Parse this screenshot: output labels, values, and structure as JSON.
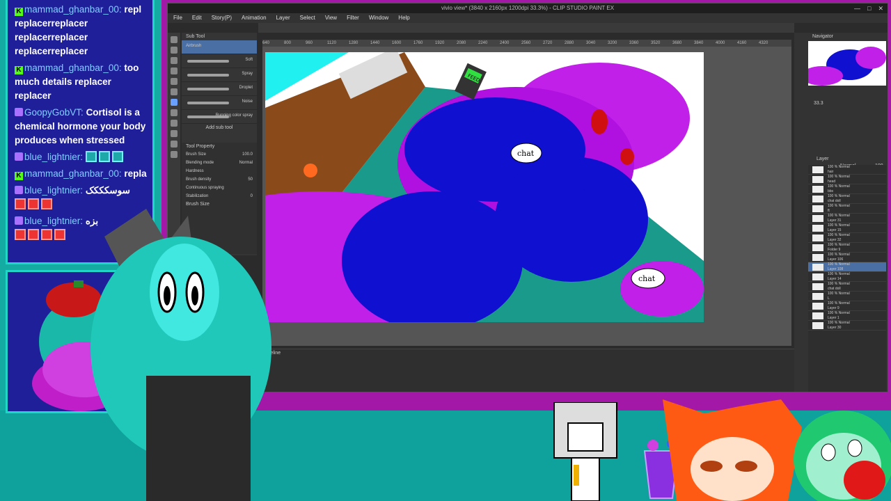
{
  "chat": {
    "messages": [
      {
        "user": "",
        "text": "replacer replacer",
        "badge": "k",
        "prefix": "mammad_ghanbar_00:",
        "tail": "repla"
      },
      {
        "user": "",
        "text": "replacer replacer"
      },
      {
        "user": "",
        "text": "replacer replacer"
      },
      {
        "user": "",
        "text": "replacer replacer"
      }
    ],
    "line1_user": "mammad_ghanbar_00:",
    "line1_text": "repl",
    "line2": "replacer",
    "line2b": "replacer",
    "line3": "replacer",
    "line3b": "replacer",
    "line4": "replacer",
    "line4b": "replacer",
    "msg2_user": "mammad_ghanbar_00:",
    "msg2_text": "too much details",
    "msg2_tail": "replacer",
    "msg2_tail2": "replacer",
    "msg3_user": "GoopyGobVT:",
    "msg3_text": "Cortisol is a chemical hormone your body produces when stressed",
    "msg4_user": "blue_lightnier:",
    "msg5_user": "mammad_ghanbar_00:",
    "msg5_text": "repla",
    "msg6_user": "blue_lightnier:",
    "msg6_text": "سوسکککک",
    "msg7_user": "blue_lightnier:",
    "msg7_text": "بزه"
  },
  "csp": {
    "title": "vivio view* (3840 x 2160px 1200dpi 33.3%) - CLIP STUDIO PAINT EX",
    "menus": [
      "File",
      "Edit",
      "Story(P)",
      "Animation",
      "Layer",
      "Select",
      "View",
      "Filter",
      "Window",
      "Help"
    ],
    "win_buttons": [
      "—",
      "□",
      "✕"
    ],
    "canvas_tab": "vivio view*",
    "subtool_title": "Sub Tool",
    "brushes": [
      {
        "name": "Airbrush",
        "tag": ""
      },
      {
        "name": "",
        "tag": "Soft"
      },
      {
        "name": "",
        "tag": "Spray"
      },
      {
        "name": "",
        "tag": "Droplet"
      },
      {
        "name": "",
        "tag": "Noise"
      },
      {
        "name": "",
        "tag": "Running color spray"
      }
    ],
    "add_sub_tool": "Add sub tool",
    "tool_property": "Tool Property",
    "props": [
      {
        "label": "Brush Size",
        "value": "100.0"
      },
      {
        "label": "Blending mode",
        "value": "Normal"
      },
      {
        "label": "Hardness",
        "value": ""
      },
      {
        "label": "Brush density",
        "value": "50"
      },
      {
        "label": "Continuous spraying",
        "value": ""
      },
      {
        "label": "Stabilization",
        "value": "0"
      }
    ],
    "brush_size_label": "Brush Size",
    "ruler_ticks": [
      "640",
      "800",
      "960",
      "1120",
      "1280",
      "1440",
      "1600",
      "1760",
      "1920",
      "2080",
      "2240",
      "2400",
      "2560",
      "2720",
      "2880",
      "3040",
      "3200",
      "3360",
      "3520",
      "3680",
      "3840",
      "4000",
      "4160",
      "4320"
    ],
    "timeline_label": "Timeline",
    "navigator_label": "Navigator",
    "zoom": "33.3",
    "layer_label": "Layer",
    "blend_mode": "Normal",
    "opacity": "100",
    "layers": [
      {
        "mode": "100 % Normal",
        "name": "hair"
      },
      {
        "mode": "100 % Normal",
        "name": "head"
      },
      {
        "mode": "100 % Normal",
        "name": "bbs"
      },
      {
        "mode": "100 % Normal",
        "name": "chat doll"
      },
      {
        "mode": "100 % Normal",
        "name": "ft"
      },
      {
        "mode": "100 % Normal",
        "name": "Layer 31"
      },
      {
        "mode": "100 % Normal",
        "name": "Layer 15"
      },
      {
        "mode": "100 % Normal",
        "name": "Layer 32"
      },
      {
        "mode": "100 % Normal",
        "name": "Folder 9"
      },
      {
        "mode": "100 % Normal",
        "name": "Layer 106"
      },
      {
        "mode": "100 % Normal",
        "name": "Layer 108"
      },
      {
        "mode": "100 % Normal",
        "name": "Layer 14"
      },
      {
        "mode": "100 % Normal",
        "name": "chat doll"
      },
      {
        "mode": "100 % Normal",
        "name": "L"
      },
      {
        "mode": "100 % Normal",
        "name": "Layer 9"
      },
      {
        "mode": "100 % Normal",
        "name": "Layer 1"
      },
      {
        "mode": "100 % Normal",
        "name": "Layer 30"
      }
    ]
  },
  "artwork": {
    "bubble1": "chat",
    "bubble2": "chat",
    "phone_text": "FEED"
  },
  "colors": {
    "overlay_teal": "#14aba3",
    "frame_purple": "#a418a8",
    "chat_bg": "#1f1f9a",
    "chat_border": "#1fd6c9",
    "art_purple": "#b120e0",
    "art_blue": "#1010d0"
  }
}
